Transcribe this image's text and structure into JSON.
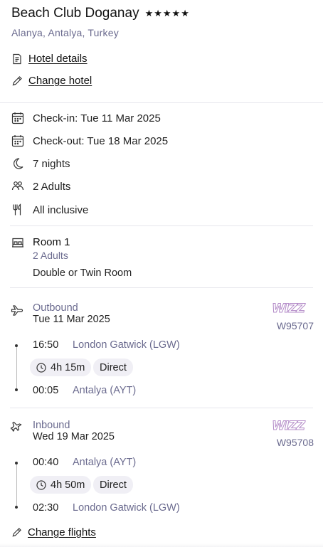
{
  "hotel": {
    "name": "Beach Club Doganay",
    "stars": "★★★★★",
    "location": "Alanya, Antalya, Turkey",
    "details_link": "Hotel details",
    "change_link": "Change hotel"
  },
  "stay": {
    "checkin": "Check-in: Tue 11 Mar 2025",
    "checkout": "Check-out: Tue 18 Mar 2025",
    "nights": "7 nights",
    "guests": "2 Adults",
    "board": "All inclusive"
  },
  "room": {
    "title": "Room 1",
    "guests": "2 Adults",
    "type": "Double or Twin Room"
  },
  "outbound": {
    "label": "Outbound",
    "date": "Tue 11 Mar 2025",
    "airline": "WIZZ",
    "flight_no": "W95707",
    "depart_time": "16:50",
    "depart_place": "London Gatwick (LGW)",
    "duration": "4h 15m",
    "stops": "Direct",
    "arrive_time": "00:05",
    "arrive_place": "Antalya (AYT)"
  },
  "inbound": {
    "label": "Inbound",
    "date": "Wed 19 Mar 2025",
    "airline": "WIZZ",
    "flight_no": "W95708",
    "depart_time": "00:40",
    "depart_place": "Antalya (AYT)",
    "duration": "4h 50m",
    "stops": "Direct",
    "arrive_time": "02:30",
    "arrive_place": "London Gatwick (LGW)"
  },
  "actions": {
    "change_flights": "Change flights"
  }
}
